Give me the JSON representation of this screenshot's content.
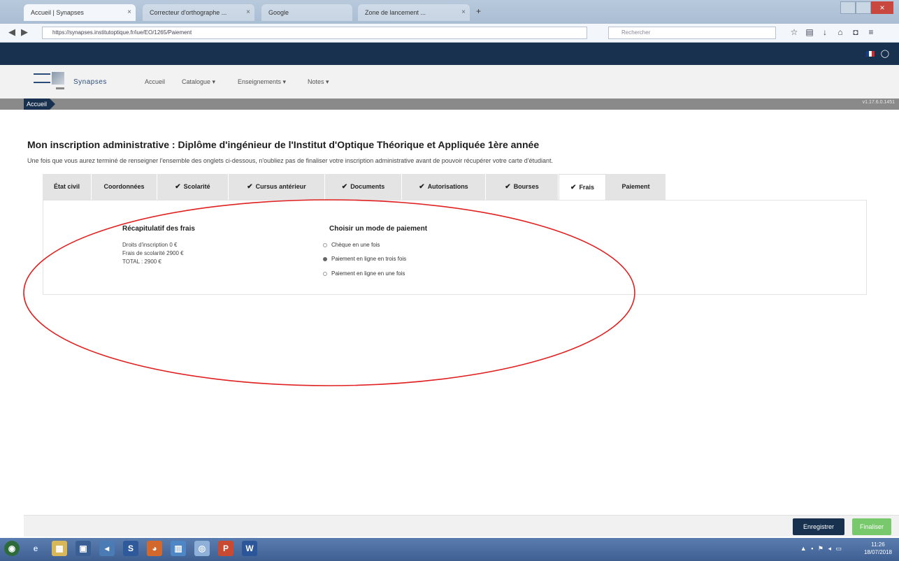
{
  "browser": {
    "tabs": [
      {
        "label": "Accueil | Synapses",
        "active": true
      },
      {
        "label": "Correcteur d'orthographe ...",
        "active": false
      },
      {
        "label": "Google",
        "active": false
      },
      {
        "label": "Zone de lancement ...",
        "active": false
      }
    ],
    "new_tab": "+",
    "close_glyph": "×",
    "url": "https://synapses.institutoptique.fr/iue/EO/1265/Paiement",
    "search_placeholder": "Rechercher"
  },
  "site": {
    "brand": "Synapses",
    "user_glyph": "◯",
    "menu": [
      "Accueil",
      "Catalogue ▾",
      "Enseignements ▾",
      "Notes ▾"
    ],
    "breadcrumb": "Accueil",
    "version": "v1.17.6.0.1451"
  },
  "page": {
    "title": "Mon inscription administrative : Diplôme d'ingénieur de l'Institut d'Optique Théorique et Appliquée 1ère année",
    "intro": "Une fois que vous aurez terminé de renseigner l'ensemble des onglets ci-dessous, n'oubliez pas de finaliser votre inscription administrative avant de pouvoir récupérer votre carte d'étudiant."
  },
  "tabs": [
    {
      "label": "État civil",
      "checked": false,
      "active": false
    },
    {
      "label": "Coordonnées",
      "checked": false,
      "active": false
    },
    {
      "label": "Scolarité",
      "checked": true,
      "active": false
    },
    {
      "label": "Cursus antérieur",
      "checked": true,
      "active": false
    },
    {
      "label": "Documents",
      "checked": true,
      "active": false
    },
    {
      "label": "Autorisations",
      "checked": true,
      "active": false
    },
    {
      "label": "Bourses",
      "checked": true,
      "active": false
    },
    {
      "label": "Frais",
      "checked": true,
      "active": true
    },
    {
      "label": "Paiement",
      "checked": false,
      "active": false
    }
  ],
  "check_glyph": "✔",
  "recap": {
    "title": "Récapitulatif des frais",
    "lines": [
      "Droits d'inscription 0 €",
      "Frais de scolarité 2900 €",
      "TOTAL : 2900 €"
    ]
  },
  "payment": {
    "title": "Choisir un mode de paiement",
    "options": [
      {
        "label": "Chèque en une fois",
        "selected": false
      },
      {
        "label": "Paiement en ligne en trois fois",
        "selected": true
      },
      {
        "label": "Paiement en ligne en une fois",
        "selected": false
      }
    ]
  },
  "actions": {
    "save": "Enregistrer",
    "finish": "Finaliser"
  },
  "taskbar": {
    "clock_time": "11:26",
    "clock_date": "18/07/2018"
  },
  "colors": {
    "primary": "#17314e",
    "success": "#78c96c",
    "annotation": "#e02020"
  }
}
